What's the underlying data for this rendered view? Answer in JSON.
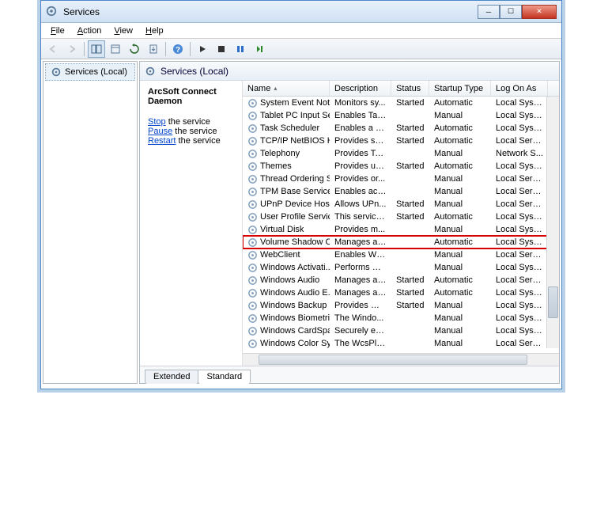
{
  "window": {
    "title": "Services"
  },
  "menu": {
    "file": "File",
    "action": "Action",
    "view": "View",
    "help": "Help"
  },
  "tree": {
    "root": "Services (Local)"
  },
  "header": {
    "label": "Services (Local)"
  },
  "detail": {
    "title": "ArcSoft Connect Daemon",
    "stop": "Stop",
    "stop_rest": " the service",
    "pause": "Pause",
    "pause_rest": " the service",
    "restart": "Restart",
    "restart_rest": " the service"
  },
  "columns": {
    "name": "Name",
    "desc": "Description",
    "status": "Status",
    "type": "Startup Type",
    "logon": "Log On As"
  },
  "tabs": {
    "extended": "Extended",
    "standard": "Standard"
  },
  "services": [
    {
      "name": "System Event Noti...",
      "desc": "Monitors sy...",
      "status": "Started",
      "type": "Automatic",
      "logon": "Local Syste..."
    },
    {
      "name": "Tablet PC Input Se...",
      "desc": "Enables Tab...",
      "status": "",
      "type": "Manual",
      "logon": "Local Syste..."
    },
    {
      "name": "Task Scheduler",
      "desc": "Enables a us...",
      "status": "Started",
      "type": "Automatic",
      "logon": "Local Syste..."
    },
    {
      "name": "TCP/IP NetBIOS H...",
      "desc": "Provides su...",
      "status": "Started",
      "type": "Automatic",
      "logon": "Local Service"
    },
    {
      "name": "Telephony",
      "desc": "Provides Tel...",
      "status": "",
      "type": "Manual",
      "logon": "Network S..."
    },
    {
      "name": "Themes",
      "desc": "Provides us...",
      "status": "Started",
      "type": "Automatic",
      "logon": "Local Syste..."
    },
    {
      "name": "Thread Ordering S...",
      "desc": "Provides or...",
      "status": "",
      "type": "Manual",
      "logon": "Local Service"
    },
    {
      "name": "TPM Base Services",
      "desc": "Enables acc...",
      "status": "",
      "type": "Manual",
      "logon": "Local Service"
    },
    {
      "name": "UPnP Device Host",
      "desc": "Allows UPn...",
      "status": "Started",
      "type": "Manual",
      "logon": "Local Service"
    },
    {
      "name": "User Profile Service",
      "desc": "This service ...",
      "status": "Started",
      "type": "Automatic",
      "logon": "Local Syste..."
    },
    {
      "name": "Virtual Disk",
      "desc": "Provides m...",
      "status": "",
      "type": "Manual",
      "logon": "Local Syste..."
    },
    {
      "name": "Volume Shadow C...",
      "desc": "Manages an...",
      "status": "",
      "type": "Automatic",
      "logon": "Local Syste...",
      "highlight": true
    },
    {
      "name": "WebClient",
      "desc": "Enables Win...",
      "status": "",
      "type": "Manual",
      "logon": "Local Service"
    },
    {
      "name": "Windows Activati...",
      "desc": "Performs W...",
      "status": "",
      "type": "Manual",
      "logon": "Local Syste..."
    },
    {
      "name": "Windows Audio",
      "desc": "Manages au...",
      "status": "Started",
      "type": "Automatic",
      "logon": "Local Service"
    },
    {
      "name": "Windows Audio E...",
      "desc": "Manages au...",
      "status": "Started",
      "type": "Automatic",
      "logon": "Local Syste..."
    },
    {
      "name": "Windows Backup",
      "desc": "Provides Wi...",
      "status": "Started",
      "type": "Manual",
      "logon": "Local Syste..."
    },
    {
      "name": "Windows Biometri...",
      "desc": "The Windo...",
      "status": "",
      "type": "Manual",
      "logon": "Local Syste..."
    },
    {
      "name": "Windows CardSpa...",
      "desc": "Securely en...",
      "status": "",
      "type": "Manual",
      "logon": "Local Syste..."
    },
    {
      "name": "Windows Color Sy...",
      "desc": "The WcsPlu...",
      "status": "",
      "type": "Manual",
      "logon": "Local Service"
    }
  ]
}
